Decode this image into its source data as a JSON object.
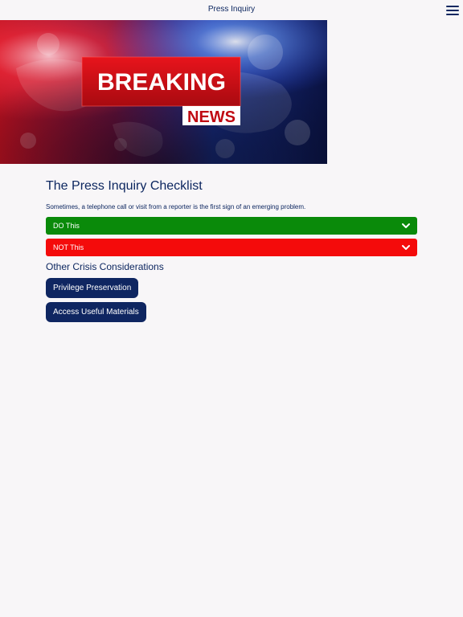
{
  "header": {
    "title": "Press Inquiry"
  },
  "hero": {
    "headline": "BREAKING",
    "subline": "NEWS"
  },
  "main": {
    "heading": "The Press Inquiry Checklist",
    "intro": "Sometimes, a telephone call or visit from a reporter is the first sign of an emerging problem.",
    "accordions": [
      {
        "label": "DO This",
        "color": "#0a8a0a"
      },
      {
        "label": "NOT This",
        "color": "#f40b0b"
      }
    ],
    "subheading": "Other Crisis Considerations",
    "buttons": [
      {
        "label": "Privilege Preservation"
      },
      {
        "label": "Access Useful Materials"
      }
    ]
  },
  "colors": {
    "text": "#0d2760",
    "button": "#0f2661",
    "background": "#f8f6f8"
  }
}
